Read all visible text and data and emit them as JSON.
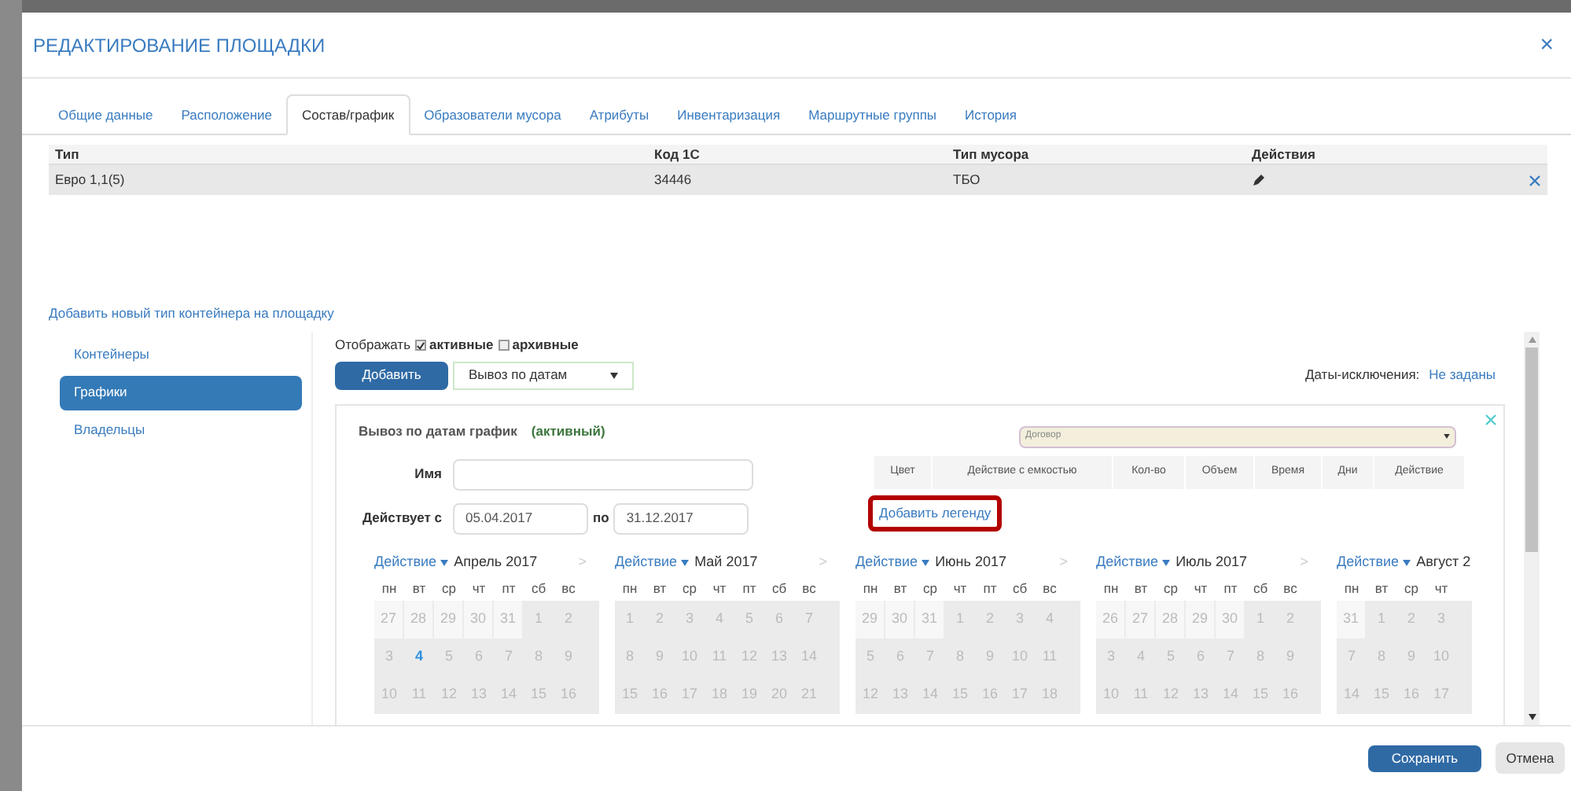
{
  "dialog": {
    "title": "РЕДАКТИРОВАНИЕ ПЛОЩАДКИ",
    "close": "×"
  },
  "tabs": [
    {
      "label": "Общие данные",
      "selected": false
    },
    {
      "label": "Расположение",
      "selected": false
    },
    {
      "label": "Состав/график",
      "selected": true
    },
    {
      "label": "Образователи мусора",
      "selected": false
    },
    {
      "label": "Атрибуты",
      "selected": false
    },
    {
      "label": "Инвентаризация",
      "selected": false
    },
    {
      "label": "Маршрутные группы",
      "selected": false
    },
    {
      "label": "История",
      "selected": false
    }
  ],
  "containers_table": {
    "columns": [
      "Тип",
      "Код 1С",
      "Тип мусора",
      "Действия"
    ],
    "rows": [
      {
        "cells": [
          "Евро 1,1(5)",
          "34446",
          "ТБО"
        ],
        "selected": true
      }
    ]
  },
  "add_container_link": "Добавить новый тип контейнера на площадку",
  "side_menu": [
    {
      "label": "Контейнеры",
      "selected": false
    },
    {
      "label": "Графики",
      "selected": true
    },
    {
      "label": "Владельцы",
      "selected": false
    }
  ],
  "filter": {
    "label": "Отображать",
    "options": [
      {
        "label": "активные",
        "checked": true
      },
      {
        "label": "архивные",
        "checked": false
      }
    ]
  },
  "add_button": "Добавить",
  "schedule_type": {
    "value": "Вывоз по датам"
  },
  "exceptions": {
    "label": "Даты-исключения:",
    "value": "Не заданы"
  },
  "schedule_card": {
    "title": "Вывоз по датам график",
    "status": "(активный)",
    "name_label": "Имя",
    "valid_from_label": "Действует с",
    "valid_from": "05.04.2017",
    "to_label": "по",
    "valid_to": "31.12.2017",
    "contract": {
      "placeholder": "Договор"
    },
    "legend_columns": [
      "Цвет",
      "Действие с емкостью",
      "Кол-во",
      "Объем",
      "Время",
      "Дни",
      "Действие"
    ],
    "add_legend_link": "Добавить легенду",
    "months": [
      {
        "action": "Действие",
        "title": "Апрель 2017",
        "next": ">",
        "weekdays": [
          "пн",
          "вт",
          "ср",
          "чт",
          "пт",
          "сб",
          "вс"
        ],
        "weeks": [
          [
            {
              "d": "27",
              "kind": "other"
            },
            {
              "d": "28",
              "kind": "other"
            },
            {
              "d": "29",
              "kind": "other"
            },
            {
              "d": "30",
              "kind": "other"
            },
            {
              "d": "31",
              "kind": "other"
            },
            {
              "d": "1",
              "kind": "day"
            },
            {
              "d": "2",
              "kind": "day"
            }
          ],
          [
            {
              "d": "3",
              "kind": "day"
            },
            {
              "d": "4",
              "kind": "today"
            },
            {
              "d": "5",
              "kind": "day"
            },
            {
              "d": "6",
              "kind": "day"
            },
            {
              "d": "7",
              "kind": "day"
            },
            {
              "d": "8",
              "kind": "day"
            },
            {
              "d": "9",
              "kind": "day"
            }
          ],
          [
            {
              "d": "10",
              "kind": "day"
            },
            {
              "d": "11",
              "kind": "day"
            },
            {
              "d": "12",
              "kind": "day"
            },
            {
              "d": "13",
              "kind": "day"
            },
            {
              "d": "14",
              "kind": "day"
            },
            {
              "d": "15",
              "kind": "day"
            },
            {
              "d": "16",
              "kind": "day"
            }
          ]
        ]
      },
      {
        "action": "Действие",
        "title": "Май 2017",
        "next": ">",
        "weekdays": [
          "пн",
          "вт",
          "ср",
          "чт",
          "пт",
          "сб",
          "вс"
        ],
        "weeks": [
          [
            {
              "d": "1",
              "kind": "day"
            },
            {
              "d": "2",
              "kind": "day"
            },
            {
              "d": "3",
              "kind": "day"
            },
            {
              "d": "4",
              "kind": "day"
            },
            {
              "d": "5",
              "kind": "day"
            },
            {
              "d": "6",
              "kind": "day"
            },
            {
              "d": "7",
              "kind": "day"
            }
          ],
          [
            {
              "d": "8",
              "kind": "day"
            },
            {
              "d": "9",
              "kind": "day"
            },
            {
              "d": "10",
              "kind": "day"
            },
            {
              "d": "11",
              "kind": "day"
            },
            {
              "d": "12",
              "kind": "day"
            },
            {
              "d": "13",
              "kind": "day"
            },
            {
              "d": "14",
              "kind": "day"
            }
          ],
          [
            {
              "d": "15",
              "kind": "day"
            },
            {
              "d": "16",
              "kind": "day"
            },
            {
              "d": "17",
              "kind": "day"
            },
            {
              "d": "18",
              "kind": "day"
            },
            {
              "d": "19",
              "kind": "day"
            },
            {
              "d": "20",
              "kind": "day"
            },
            {
              "d": "21",
              "kind": "day"
            }
          ]
        ]
      },
      {
        "action": "Действие",
        "title": "Июнь 2017",
        "next": ">",
        "weekdays": [
          "пн",
          "вт",
          "ср",
          "чт",
          "пт",
          "сб",
          "вс"
        ],
        "weeks": [
          [
            {
              "d": "29",
              "kind": "other"
            },
            {
              "d": "30",
              "kind": "other"
            },
            {
              "d": "31",
              "kind": "other"
            },
            {
              "d": "1",
              "kind": "day"
            },
            {
              "d": "2",
              "kind": "day"
            },
            {
              "d": "3",
              "kind": "day"
            },
            {
              "d": "4",
              "kind": "day"
            }
          ],
          [
            {
              "d": "5",
              "kind": "day"
            },
            {
              "d": "6",
              "kind": "day"
            },
            {
              "d": "7",
              "kind": "day"
            },
            {
              "d": "8",
              "kind": "day"
            },
            {
              "d": "9",
              "kind": "day"
            },
            {
              "d": "10",
              "kind": "day"
            },
            {
              "d": "11",
              "kind": "day"
            }
          ],
          [
            {
              "d": "12",
              "kind": "day"
            },
            {
              "d": "13",
              "kind": "day"
            },
            {
              "d": "14",
              "kind": "day"
            },
            {
              "d": "15",
              "kind": "day"
            },
            {
              "d": "16",
              "kind": "day"
            },
            {
              "d": "17",
              "kind": "day"
            },
            {
              "d": "18",
              "kind": "day"
            }
          ]
        ]
      },
      {
        "action": "Действие",
        "title": "Июль 2017",
        "next": ">",
        "weekdays": [
          "пн",
          "вт",
          "ср",
          "чт",
          "пт",
          "сб",
          "вс"
        ],
        "weeks": [
          [
            {
              "d": "26",
              "kind": "other"
            },
            {
              "d": "27",
              "kind": "other"
            },
            {
              "d": "28",
              "kind": "other"
            },
            {
              "d": "29",
              "kind": "other"
            },
            {
              "d": "30",
              "kind": "other"
            },
            {
              "d": "1",
              "kind": "day"
            },
            {
              "d": "2",
              "kind": "day"
            }
          ],
          [
            {
              "d": "3",
              "kind": "day"
            },
            {
              "d": "4",
              "kind": "day"
            },
            {
              "d": "5",
              "kind": "day"
            },
            {
              "d": "6",
              "kind": "day"
            },
            {
              "d": "7",
              "kind": "day"
            },
            {
              "d": "8",
              "kind": "day"
            },
            {
              "d": "9",
              "kind": "day"
            }
          ],
          [
            {
              "d": "10",
              "kind": "day"
            },
            {
              "d": "11",
              "kind": "day"
            },
            {
              "d": "12",
              "kind": "day"
            },
            {
              "d": "13",
              "kind": "day"
            },
            {
              "d": "14",
              "kind": "day"
            },
            {
              "d": "15",
              "kind": "day"
            },
            {
              "d": "16",
              "kind": "day"
            }
          ]
        ]
      },
      {
        "action": "Действие",
        "title": "Август 2",
        "weekdays": [
          "пн",
          "вт",
          "ср",
          "чт"
        ],
        "weeks": [
          [
            {
              "d": "31",
              "kind": "other"
            },
            {
              "d": "1",
              "kind": "day"
            },
            {
              "d": "2",
              "kind": "day"
            },
            {
              "d": "3",
              "kind": "day"
            }
          ],
          [
            {
              "d": "7",
              "kind": "day"
            },
            {
              "d": "8",
              "kind": "day"
            },
            {
              "d": "9",
              "kind": "day"
            },
            {
              "d": "10",
              "kind": "day"
            }
          ],
          [
            {
              "d": "14",
              "kind": "day"
            },
            {
              "d": "15",
              "kind": "day"
            },
            {
              "d": "16",
              "kind": "day"
            },
            {
              "d": "17",
              "kind": "day"
            }
          ]
        ]
      }
    ]
  },
  "footer": {
    "save": "Сохранить",
    "cancel": "Отмена"
  }
}
